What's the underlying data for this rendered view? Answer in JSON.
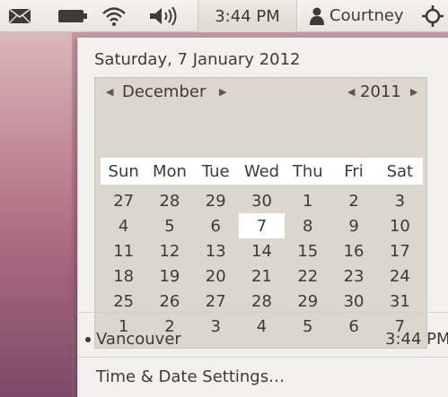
{
  "panel": {
    "icons": [
      "mail-icon",
      "battery-icon",
      "wifi-icon",
      "volume-icon",
      "user-icon",
      "power-icon"
    ],
    "clock": "3:44 PM",
    "user": "Courtney"
  },
  "menu": {
    "date_title": "Saturday, 7 January 2012",
    "month": "December",
    "year": "2011",
    "weekdays": [
      "Sun",
      "Mon",
      "Tue",
      "Wed",
      "Thu",
      "Fri",
      "Sat"
    ],
    "days": [
      [
        "27",
        "28",
        "29",
        "30",
        "1",
        "2",
        "3"
      ],
      [
        "4",
        "5",
        "6",
        "7",
        "8",
        "9",
        "10"
      ],
      [
        "11",
        "12",
        "13",
        "14",
        "15",
        "16",
        "17"
      ],
      [
        "18",
        "19",
        "20",
        "21",
        "22",
        "23",
        "24"
      ],
      [
        "25",
        "26",
        "27",
        "28",
        "29",
        "30",
        "31"
      ],
      [
        "1",
        "2",
        "3",
        "4",
        "5",
        "6",
        "7"
      ]
    ],
    "highlighted_day": "7",
    "location": {
      "name": "Vancouver",
      "time": "3:44 PM"
    },
    "settings_label": "Time & Date Settings…"
  },
  "colors": {
    "panel_bg": "#e8e5de",
    "menu_bg": "#f2f1f0",
    "calendar_bg": "#dcd6cd",
    "text": "#3c3b37"
  }
}
